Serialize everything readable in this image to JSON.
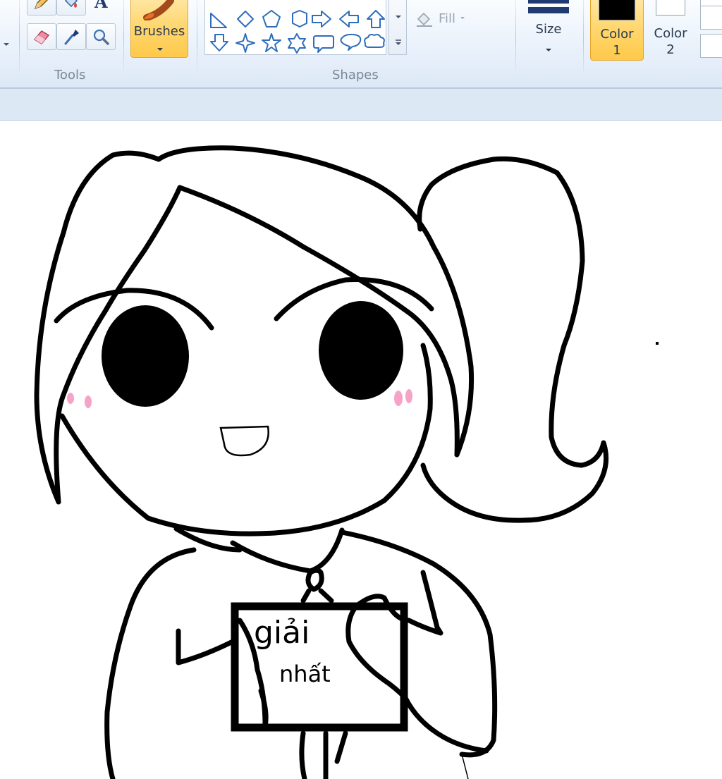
{
  "ribbon": {
    "tools": {
      "group_label": "Tools",
      "icons": [
        "pencil-icon",
        "fill-bucket-icon",
        "text-icon",
        "eraser-icon",
        "color-picker-icon",
        "magnifier-icon"
      ]
    },
    "brushes": {
      "label": "Brushes",
      "icon": "brush-icon",
      "selected": true
    },
    "shapes": {
      "group_label": "Shapes",
      "items": [
        "right-triangle",
        "diamond",
        "pentagon",
        "hexagon",
        "right-arrow",
        "left-arrow",
        "up-arrow",
        "down-arrow",
        "four-point-star",
        "five-point-star",
        "six-point-star",
        "rounded-callout",
        "oval-callout",
        "cloud-callout"
      ]
    },
    "fill": {
      "label": "Fill"
    },
    "size": {
      "label": "Size"
    },
    "color1": {
      "label_line1": "Color",
      "label_line2": "1",
      "value": "#000000",
      "selected": true
    },
    "color2": {
      "label_line1": "Color",
      "label_line2": "2",
      "value": "#ffffff"
    }
  },
  "canvas": {
    "sign_text_line1": "giải",
    "sign_text_line2": "nhất"
  },
  "colors": {
    "ribbon_bg": "#e9f1fb",
    "highlight": "#ffd56a",
    "blush": "#f6a3c8",
    "ink": "#000000"
  }
}
